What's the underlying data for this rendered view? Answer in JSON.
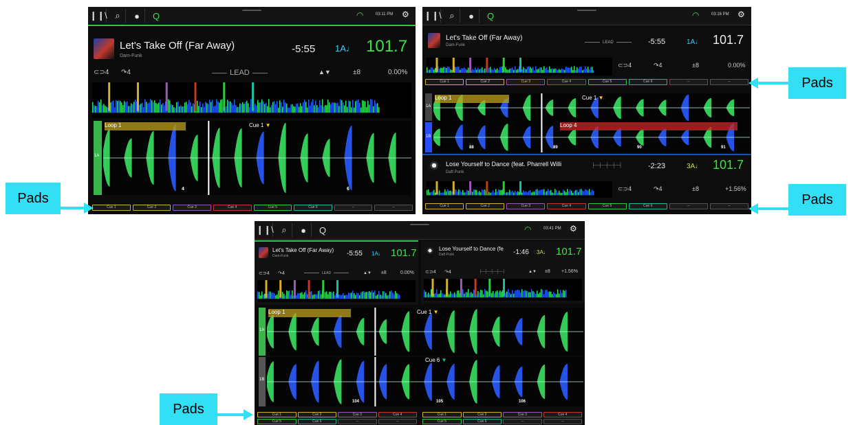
{
  "callout": {
    "pads": "Pads"
  },
  "screens": [
    {
      "time": "03:11 PM",
      "deckA": {
        "title": "Let's Take Off (Far Away)",
        "artist": "Dam-Funk",
        "remaining": "-5:55",
        "key": "1A♩",
        "bpm": "101.7",
        "loop_count": "4",
        "jump_count": "4",
        "lead": "LEAD",
        "pitch_range": "±8",
        "pitch": "0.00%",
        "loop_label": "Loop 1",
        "cue_label": "Cue 1",
        "lane_label": "1A",
        "beat": "4",
        "beat2": "6"
      },
      "pads": [
        "Cue 1",
        "Cue 2",
        "Cue 3",
        "Cue 4",
        "Cue 5",
        "Cue 6",
        "--",
        "--"
      ]
    },
    {
      "time": "03:16 PM",
      "deckA": {
        "title": "Let's Take Off (Far Away)",
        "artist": "Dam-Funk",
        "lead": "LEAD",
        "remaining": "-5:55",
        "key": "1A♩",
        "bpm": "101.7",
        "loop_count": "4",
        "jump_count": "4",
        "pitch_range": "±8",
        "pitch": "0.00%",
        "loop_label": "Loop 1",
        "cue_label": "Cue 1",
        "lane_label": "1A"
      },
      "deckB": {
        "title": "Lose Yourself to Dance (feat. Pharrell Willi",
        "artist": "Daft Punk",
        "remaining": "-2:23",
        "key": "3A♩",
        "bpm": "101.7",
        "loop_count": "4",
        "jump_count": "4",
        "pitch_range": "±8",
        "pitch": "+1.56%",
        "loop_label": "Loop 4",
        "lane_label": "1B",
        "beats": [
          "88",
          "89",
          "90",
          "91"
        ]
      },
      "padsA": [
        "Cue 1",
        "Cue 2",
        "Cue 3",
        "Cue 4",
        "Cue 5",
        "Cue 6",
        "--",
        "--"
      ],
      "padsB": [
        "Cue 1",
        "Cue 2",
        "Cue 3",
        "Cue 4",
        "Cue 5",
        "Cue 6",
        "--",
        "--"
      ]
    },
    {
      "time": "03:41 PM",
      "deckA": {
        "title": "Let's Take Off (Far Away)",
        "artist": "Dam-Funk",
        "remaining": "-5:55",
        "key": "1A♩",
        "bpm": "101.7",
        "loop_count": "4",
        "jump_count": "4",
        "lead": "LEAD",
        "pitch_range": "±8",
        "pitch": "0.00%",
        "loop_label": "Loop 1",
        "cue_label": "Cue 1",
        "lane_label": "1A"
      },
      "deckB": {
        "title": "Lose Yourself to Dance (fe",
        "artist": "Daft Punk",
        "remaining": "-1:46",
        "key": "3A♩",
        "bpm": "101.7",
        "loop_count": "4",
        "jump_count": "4",
        "pitch_range": "±8",
        "pitch": "+1.56%",
        "cue_label": "Cue 6",
        "lane_label": "1B",
        "beats": [
          "104",
          "105",
          "106"
        ]
      },
      "padsA": [
        "Cue 1",
        "Cue 2",
        "Cue 3",
        "Cue 4",
        "Cue 5",
        "Cue 6",
        "--",
        "--"
      ],
      "padsB": [
        "Cue 1",
        "Cue 2",
        "Cue 3",
        "Cue 4",
        "Cue 5",
        "Cue 6",
        "--",
        "--"
      ]
    }
  ],
  "colors": {
    "accent_green": "#3fe04b",
    "key_blue": "#2fd7ff",
    "callout": "#33dff5",
    "wave_green": "#38e060",
    "wave_blue": "#2a5cff"
  },
  "cue_colors": [
    "#d4b030",
    "#d4b030",
    "#9b59b6",
    "#c0392b",
    "#2ecc40",
    "#1abc9c",
    "#555555",
    "#555555"
  ]
}
